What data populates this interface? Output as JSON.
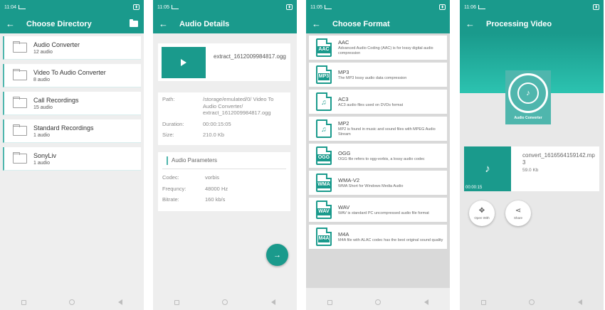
{
  "colors": {
    "primary": "#1a9a8c",
    "accent": "#4fb6ad"
  },
  "screens": {
    "directory": {
      "status_time": "11:04",
      "title": "Choose Directory",
      "items": [
        {
          "name": "Audio Converter",
          "count": "12 audio"
        },
        {
          "name": "Video To Audio Converter",
          "count": "8 audio"
        },
        {
          "name": "Call Recordings",
          "count": "15 audio"
        },
        {
          "name": "Standard Recordings",
          "count": "1 audio"
        },
        {
          "name": "SonyLiv",
          "count": "1 audio"
        }
      ]
    },
    "details": {
      "status_time": "11:05",
      "title": "Audio Details",
      "file_name": "extract_1612009984817.ogg",
      "path_label": "Path:",
      "path_value": "/storage/emulated/0/ Video To Audio Converter/ extract_1612009984817.ogg",
      "duration_label": "Duration:",
      "duration_value": "00:00:15:05",
      "size_label": "Size:",
      "size_value": "210.0 Kb",
      "params_title": "Audio Parameters",
      "codec_label": "Codec:",
      "codec_value": "vorbis",
      "freq_label": "Frequncy:",
      "freq_value": "48000  Hz",
      "bitrate_label": "Bitrate:",
      "bitrate_value": "160  kb/s"
    },
    "format": {
      "status_time": "11:05",
      "title": "Choose Format",
      "items": [
        {
          "label": "AAC",
          "icon": "label",
          "desc": "Advanced Audio Coding (AAC) is for lossy digital audio compression"
        },
        {
          "label": "MP3",
          "icon": "label",
          "desc": "The MP3 lossy audio data compression"
        },
        {
          "label": "AC3",
          "icon": "note",
          "desc": "AC3 audio files used on DVDs format"
        },
        {
          "label": "MP2",
          "icon": "note",
          "desc": "MP2 is found in music and sound files with MPEG Audio Stream"
        },
        {
          "label": "OGG",
          "icon": "label",
          "desc": "OGG file refers to ogg-vorbis, a lossy audio codec"
        },
        {
          "label": "WMA-V2",
          "icon": "WMA",
          "desc": "WMA Short for Windows Media Audio"
        },
        {
          "label": "WAV",
          "icon": "label",
          "desc": "WAV is standard PC uncompressed audio file format"
        },
        {
          "label": "M4A",
          "icon": "label",
          "desc": "M4A file with ALAC codec has the best original sound quality"
        }
      ]
    },
    "processing": {
      "status_time": "11:06",
      "title": "Processing Video",
      "logo_caption": "Audio Converter",
      "output_name": "convert_1616564159142.mp3",
      "output_size": "59.0 Kb",
      "output_time": "00:00:15",
      "open_with_label": "Open With",
      "share_label": "Share"
    }
  }
}
